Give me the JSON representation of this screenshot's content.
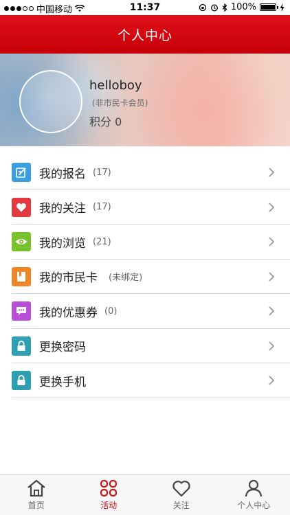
{
  "status_bar": {
    "carrier": "中国移动",
    "time": "11:37",
    "battery": "100%"
  },
  "nav": {
    "title": "个人中心"
  },
  "profile": {
    "username": "helloboy",
    "member_status": "(非市民卡会员)",
    "points_label": "积分 0"
  },
  "menu": {
    "items": [
      {
        "label": "我的报名",
        "count": "(17)",
        "icon": "edit-icon",
        "color": "#3a9ee0"
      },
      {
        "label": "我的关注",
        "count": "(17)",
        "icon": "heart-icon",
        "color": "#e23a3e"
      },
      {
        "label": "我的浏览",
        "count": "(21)",
        "icon": "eye-icon",
        "color": "#7ac12e"
      },
      {
        "label": "我的市民卡",
        "count": "(未绑定)",
        "icon": "card-icon",
        "color": "#f0862a"
      },
      {
        "label": "我的优惠券",
        "count": "(0)",
        "icon": "chat-icon",
        "color": "#b84fd6"
      },
      {
        "label": "更换密码",
        "count": "",
        "icon": "lock-icon",
        "color": "#2e9fb0"
      },
      {
        "label": "更换手机",
        "count": "",
        "icon": "lock-icon",
        "color": "#2e9fb0"
      }
    ]
  },
  "tabs": [
    {
      "label": "首页",
      "icon": "home-icon",
      "active": false
    },
    {
      "label": "活动",
      "icon": "grid-icon",
      "active": true
    },
    {
      "label": "关注",
      "icon": "heart-outline-icon",
      "active": false
    },
    {
      "label": "个人中心",
      "icon": "person-icon",
      "active": false
    }
  ],
  "colors": {
    "brand_red": "#d0121b",
    "nav_gradient_top": "#e0101a",
    "nav_gradient_bottom": "#c60008"
  }
}
